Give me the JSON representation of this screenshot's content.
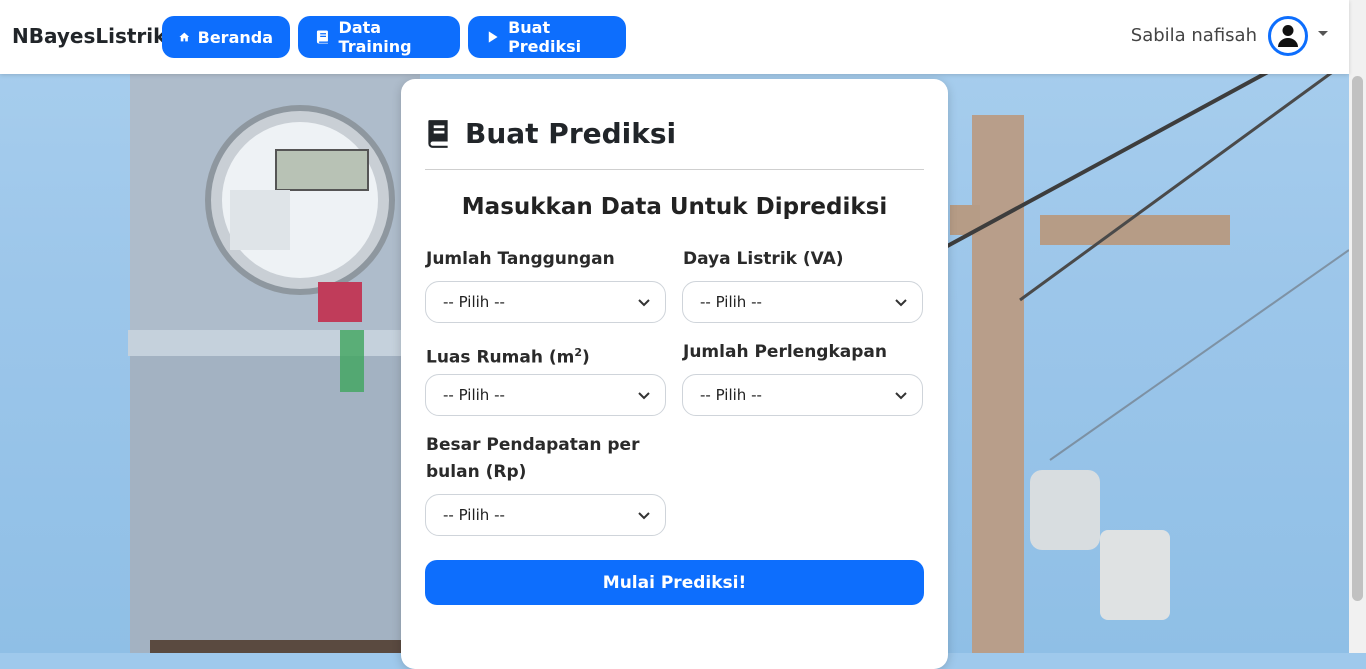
{
  "navbar": {
    "brand": "NBayesListrik",
    "buttons": [
      {
        "label": "Beranda",
        "icon": "home-icon"
      },
      {
        "label": "Data Training",
        "icon": "book-icon"
      },
      {
        "label": "Buat Prediksi",
        "icon": "play-icon"
      }
    ],
    "user_name": "Sabila nafisah"
  },
  "card": {
    "title": "Buat Prediksi",
    "subtitle": "Masukkan Data Untuk Diprediksi",
    "fields": [
      {
        "label": "Jumlah Tanggungan",
        "value": "-- Pilih --"
      },
      {
        "label": "Daya Listrik (VA)",
        "value": "-- Pilih --"
      },
      {
        "label_prefix": "Luas Rumah (m",
        "label_sup": "2",
        "label_suffix": ")",
        "value": "-- Pilih --"
      },
      {
        "label": "Jumlah Perlengkapan",
        "value": "-- Pilih --"
      },
      {
        "label_line1": "Besar Pendapatan per",
        "label_line2": "bulan (Rp)",
        "value": "-- Pilih --"
      }
    ],
    "submit_label": "Mulai Prediksi!"
  },
  "colors": {
    "primary": "#0d6efd",
    "sky": "#9fc9ec"
  }
}
